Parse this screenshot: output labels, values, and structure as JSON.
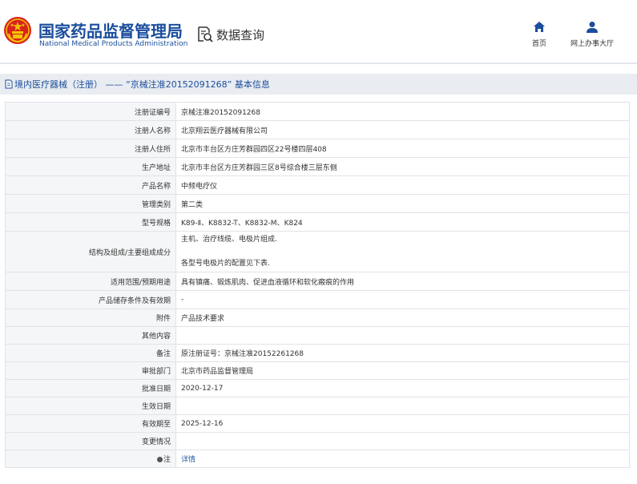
{
  "header": {
    "site_name": "国家药品监督管理局",
    "site_name_en": "National Medical Products Administration",
    "query_label": "数据查询",
    "nav": [
      {
        "label": "首页",
        "icon": "home-icon"
      },
      {
        "label": "网上办事大厅",
        "icon": "user-icon"
      }
    ]
  },
  "breadcrumb": {
    "title": "境内医疗器械（注册） —— “京械注准20152091268” 基本信息"
  },
  "details": {
    "rows": [
      {
        "label": "注册证编号",
        "value": "京械注准20152091268"
      },
      {
        "label": "注册人名称",
        "value": "北京翔云医疗器械有限公司"
      },
      {
        "label": "注册人住所",
        "value": "北京市丰台区方庄芳群园四区22号楼四层408"
      },
      {
        "label": "生产地址",
        "value": "北京市丰台区方庄芳群园三区8号综合楼三层东侧"
      },
      {
        "label": "产品名称",
        "value": "中频电疗仪"
      },
      {
        "label": "管理类别",
        "value": "第二类"
      },
      {
        "label": "型号规格",
        "value": "K89-Ⅱ、K8832-T、K8832-M、K824"
      },
      {
        "label": "结构及组成/主要组成成分",
        "value_line1": "主机、治疗线缆、电极片组成.",
        "value_line2": "各型号电极片的配置见下表."
      },
      {
        "label": "适用范围/预期用途",
        "value": "具有镇痛、锻炼肌肉、促进血液循环和软化瘢痕的作用"
      },
      {
        "label": "产品储存条件及有效期",
        "value": "-"
      },
      {
        "label": "附件",
        "value": "产品技术要求"
      },
      {
        "label": "其他内容",
        "value": ""
      },
      {
        "label": "备注",
        "value": "原注册证号：京械注准20152261268"
      },
      {
        "label": "审批部门",
        "value": "北京市药品监督管理局"
      },
      {
        "label": "批准日期",
        "value": "2020-12-17"
      },
      {
        "label": "生效日期",
        "value": ""
      },
      {
        "label": "有效期至",
        "value": "2025-12-16"
      },
      {
        "label": "变更情况",
        "value": ""
      },
      {
        "label": "注",
        "label_icon": "info-icon",
        "value": "详情"
      }
    ]
  },
  "colors": {
    "brand_blue": "#1a4d9c",
    "emblem_red": "#d8231f",
    "emblem_gold": "#f5c400",
    "label_bg": "#f5f6f8",
    "bar_bg": "#e9ecf1",
    "link_blue": "#2a5caa"
  }
}
